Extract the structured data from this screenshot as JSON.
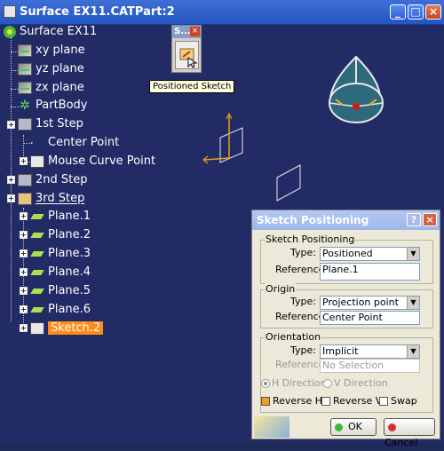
{
  "window": {
    "title": "Surface EX11.CATPart:2",
    "buttons": {
      "minimize": "_",
      "maximize": "□",
      "close": "×"
    }
  },
  "tree": {
    "root": "Surface EX11",
    "items": {
      "xy": "xy plane",
      "yz": "yz plane",
      "zx": "zx plane",
      "partbody": "PartBody",
      "step1": "1st Step",
      "center_point": "Center Point",
      "mouse_curve_point": "Mouse Curve Point",
      "step2": "2nd Step",
      "step3": "3rd Step",
      "plane1": "Plane.1",
      "plane2": "Plane.2",
      "plane3": "Plane.3",
      "plane4": "Plane.4",
      "plane5": "Plane.5",
      "plane6": "Plane.6",
      "sketch2": "Sketch.2"
    }
  },
  "mini_toolbar": {
    "title": "S...",
    "close": "×"
  },
  "tooltip": "Positioned Sketch",
  "dialog": {
    "title": "Sketch Positioning",
    "help": "?",
    "close": "×",
    "sketch_positioning": {
      "group": "Sketch Positioning",
      "type_label": "Type:",
      "type_value": "Positioned",
      "reference_label": "Reference:",
      "reference_value": "Plane.1"
    },
    "origin": {
      "group": "Origin",
      "type_label": "Type:",
      "type_value": "Projection point",
      "reference_label": "Reference:",
      "reference_value": "Center Point"
    },
    "orientation": {
      "group": "Orientation",
      "type_label": "Type:",
      "type_value": "Implicit",
      "reference_label": "Reference:",
      "reference_value": "No Selection",
      "h_direction": "H Direction",
      "v_direction": "V Direction",
      "reverse_h": "Reverse H",
      "reverse_v": "Reverse V",
      "swap": "Swap"
    },
    "ok": "OK",
    "cancel": "Cancel"
  },
  "colors": {
    "selection": "#ff8c1a",
    "background": "#232b66"
  }
}
